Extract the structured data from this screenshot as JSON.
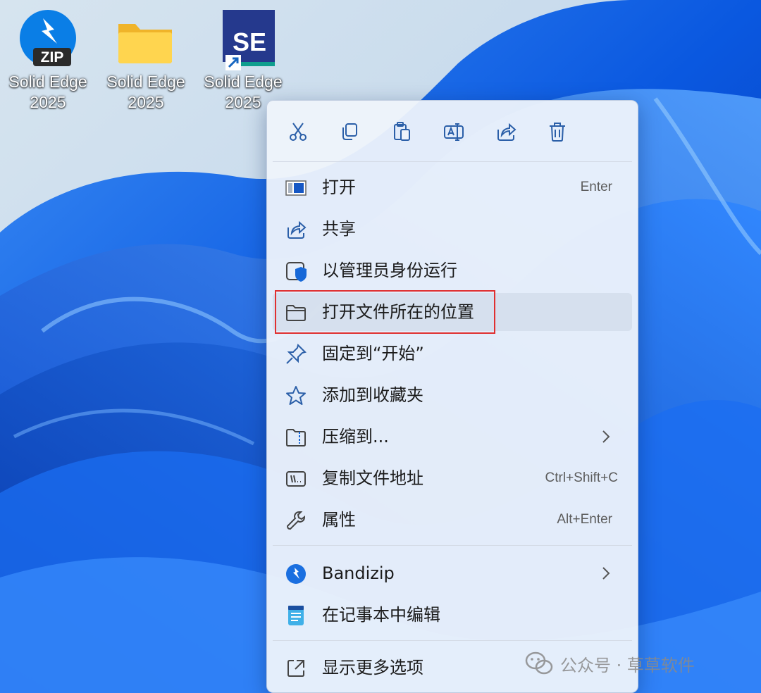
{
  "desktop": {
    "icons": [
      {
        "label_line1": "Solid Edge",
        "label_line2": "2025",
        "badge": "ZIP"
      },
      {
        "label_line1": "Solid Edge",
        "label_line2": "2025"
      },
      {
        "label_line1": "Solid Edge",
        "label_line2": "2025",
        "badge": "SE"
      }
    ]
  },
  "toolbar": {
    "buttons": [
      {
        "icon": "cut-icon"
      },
      {
        "icon": "copy-icon"
      },
      {
        "icon": "paste-icon"
      },
      {
        "icon": "rename-icon"
      },
      {
        "icon": "share-icon"
      },
      {
        "icon": "delete-icon"
      }
    ]
  },
  "menu": {
    "items": [
      {
        "label": "打开",
        "accel": "Enter",
        "icon": "app-window-icon"
      },
      {
        "label": "共享",
        "icon": "share-icon"
      },
      {
        "label": "以管理员身份运行",
        "icon": "shield-icon"
      },
      {
        "label": "打开文件所在的位置",
        "icon": "folder-icon",
        "highlighted": true
      },
      {
        "label": "固定到“开始”",
        "icon": "pin-icon"
      },
      {
        "label": "添加到收藏夹",
        "icon": "star-icon"
      },
      {
        "label": "压缩到...",
        "icon": "zip-folder-icon",
        "submenu": true
      },
      {
        "label": "复制文件地址",
        "accel": "Ctrl+Shift+C",
        "icon": "copy-path-icon"
      },
      {
        "label": "属性",
        "accel": "Alt+Enter",
        "icon": "wrench-icon"
      },
      {
        "label": "Bandizip",
        "icon": "bandizip-icon",
        "submenu": true
      },
      {
        "label": "在记事本中编辑",
        "icon": "notepad-icon"
      },
      {
        "label": "显示更多选项",
        "icon": "expand-icon"
      }
    ]
  },
  "watermark": {
    "text": "公众号 · 草草软件"
  },
  "colors": {
    "accent": "#0067c0",
    "highlight_box": "#e03030"
  }
}
